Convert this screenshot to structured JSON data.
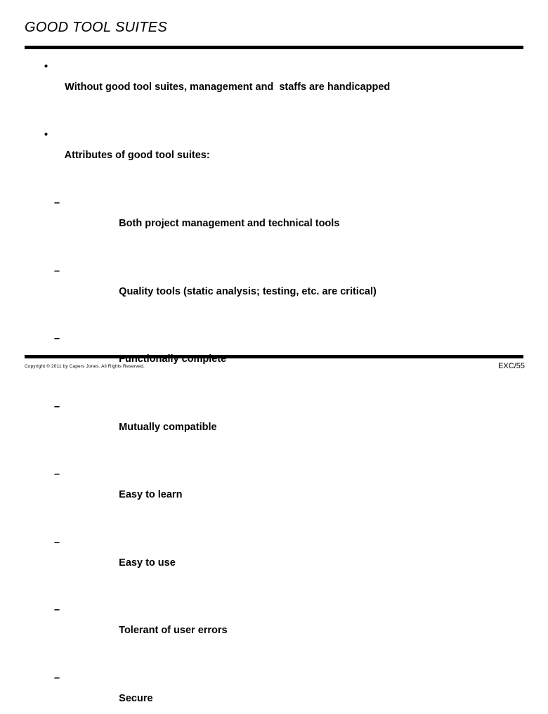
{
  "slide": {
    "title": "GOOD TOOL SUITES",
    "bullets_level1": [
      {
        "marker": "•",
        "text": "Without good tool suites, management and  staffs are handicapped"
      },
      {
        "marker": "•",
        "text": "Attributes of good tool suites:"
      }
    ],
    "bullets_level2": [
      {
        "marker": "–",
        "text": "Both project management and technical tools"
      },
      {
        "marker": "–",
        "text": "Quality tools (static analysis; testing, etc. are critical)"
      },
      {
        "marker": "–",
        "text": "Functionally complete"
      },
      {
        "marker": "–",
        "text": "Mutually compatible"
      },
      {
        "marker": "–",
        "text": "Easy to learn"
      },
      {
        "marker": "–",
        "text": "Easy to use"
      },
      {
        "marker": "–",
        "text": "Tolerant of user errors"
      },
      {
        "marker": "–",
        "text": "Secure"
      }
    ],
    "footer": {
      "copyright": "Copyright © 2011 by Capers Jones. All Rights Reserved.",
      "page_id": "EXC/55"
    },
    "colors": {
      "background": "#ffffff",
      "text": "#000000",
      "rule": "#000000"
    }
  }
}
